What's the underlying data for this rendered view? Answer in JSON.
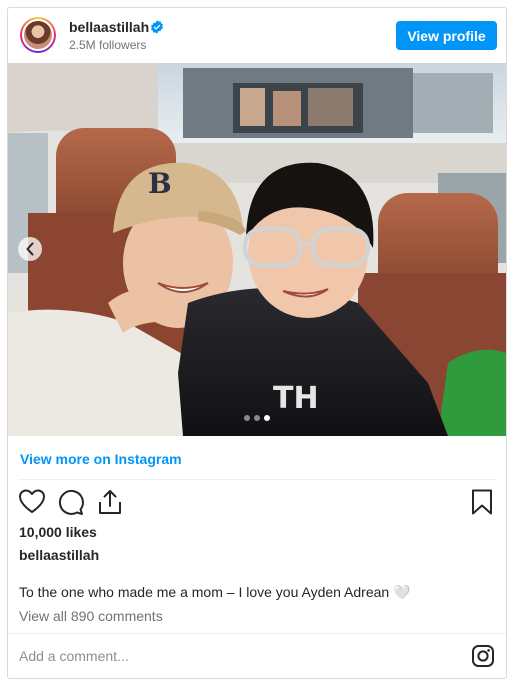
{
  "header": {
    "username": "bellaastillah",
    "verified_icon": "verified-badge-icon",
    "followers": "2.5M followers",
    "view_profile_label": "View profile"
  },
  "post": {
    "image_alt": "Selfie of a woman in a beige B cap with a boy wearing glasses inside a car with a sunroof",
    "carousel": {
      "slide_count": 3,
      "active_slide": 3
    },
    "view_more_label": "View more on Instagram",
    "likes": "10,000 likes",
    "caption_username": "bellaastillah",
    "caption_text": "To the one who made me a mom – I love you Ayden Adrean 🤍",
    "view_comments": "View all 890 comments",
    "add_comment_placeholder": "Add a comment..."
  },
  "icons": {
    "like": "heart-icon",
    "comment": "comment-icon",
    "share": "share-icon",
    "save": "bookmark-icon",
    "instagram": "instagram-icon",
    "prev": "chevron-left-icon"
  },
  "colors": {
    "primary_button": "#0095f6",
    "link": "#0095f6",
    "text": "#262626",
    "muted": "#737373",
    "border": "#dbdbdb"
  }
}
